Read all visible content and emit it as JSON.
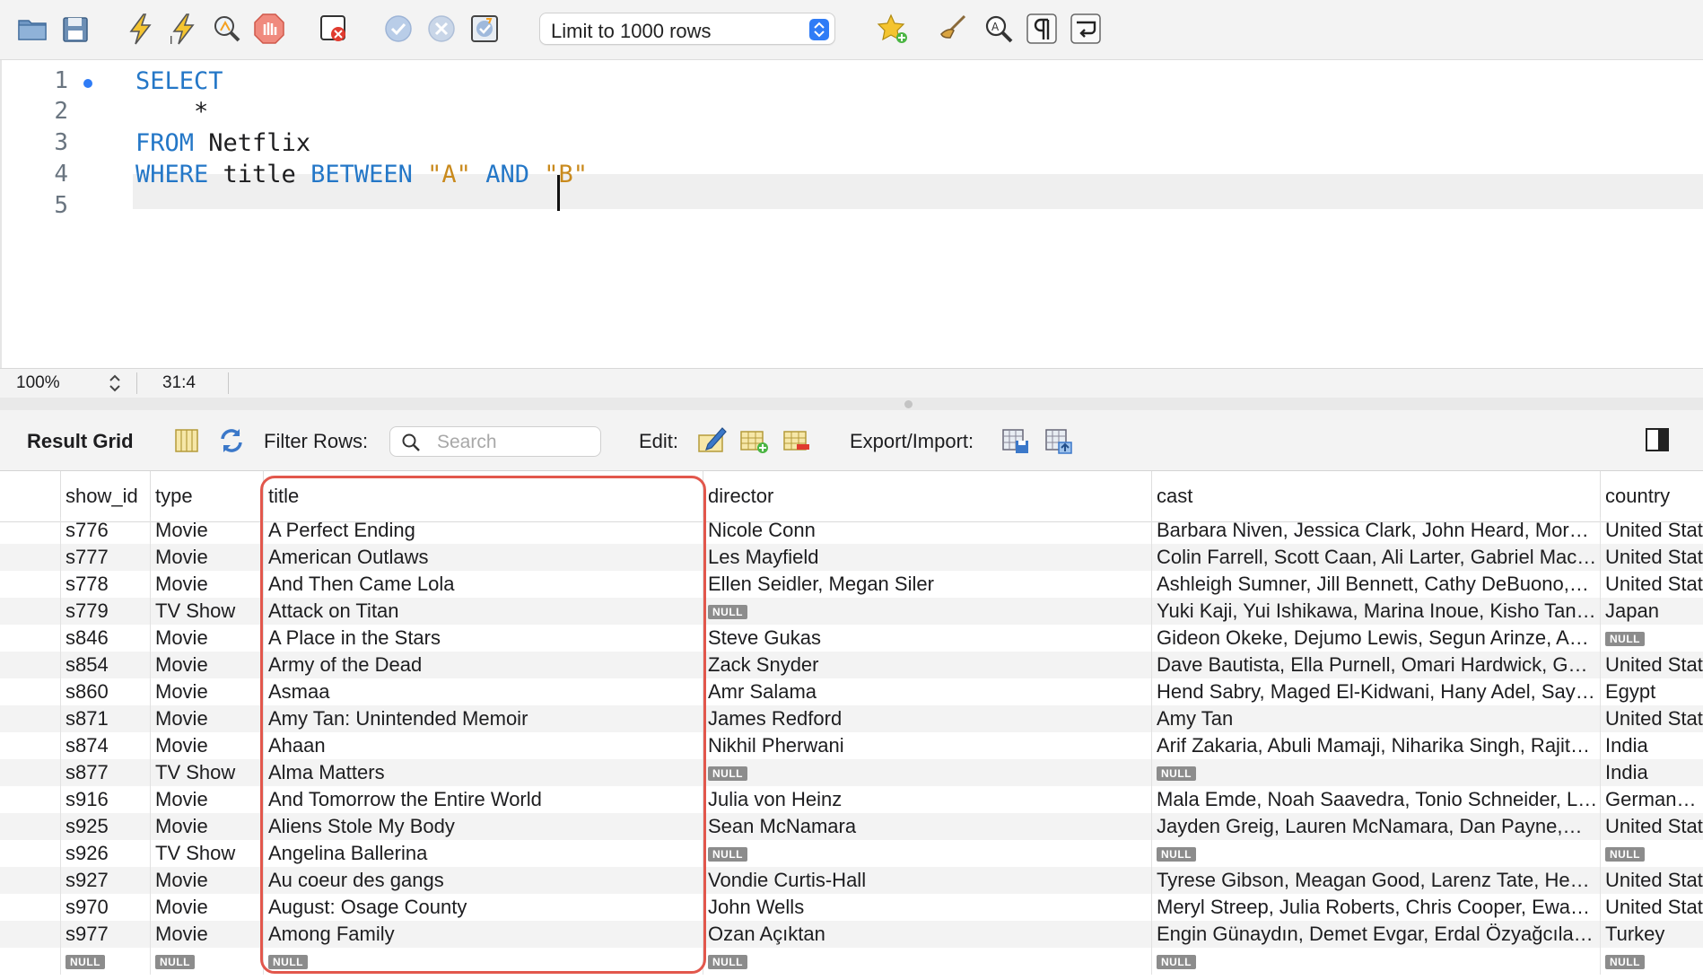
{
  "toolbar": {
    "icons": [
      "open-folder-icon",
      "save-icon",
      "execute-icon",
      "execute-current-icon",
      "explain-icon",
      "stop-icon",
      "toggle-error-icon",
      "commit-icon",
      "rollback-icon",
      "autocommit-icon",
      "bookmark-star-icon",
      "beautify-icon",
      "find-icon",
      "invisible-chars-icon",
      "word-wrap-icon"
    ],
    "limit_label": "Limit to 1000 rows"
  },
  "editor": {
    "lines": [
      {
        "no": "1",
        "parts": [
          {
            "t": "SELECT",
            "k": "kw"
          }
        ]
      },
      {
        "no": "2",
        "parts": [
          {
            "t": "    *",
            "k": "plain"
          }
        ]
      },
      {
        "no": "3",
        "parts": [
          {
            "t": "FROM",
            "k": "kw"
          },
          {
            "t": " Netflix",
            "k": "plain"
          }
        ]
      },
      {
        "no": "4",
        "parts": [
          {
            "t": "WHERE",
            "k": "kw"
          },
          {
            "t": " title ",
            "k": "plain"
          },
          {
            "t": "BETWEEN",
            "k": "kw"
          },
          {
            "t": " ",
            "k": "plain"
          },
          {
            "t": "\"A\"",
            "k": "str"
          },
          {
            "t": " ",
            "k": "plain"
          },
          {
            "t": "AND",
            "k": "kw"
          },
          {
            "t": " ",
            "k": "plain"
          },
          {
            "t": "\"B\"",
            "k": "str"
          }
        ]
      },
      {
        "no": "5",
        "parts": []
      }
    ]
  },
  "status": {
    "zoom": "100%",
    "cursor": "31:4"
  },
  "result_bar": {
    "result_grid_label": "Result Grid",
    "filter_label": "Filter Rows:",
    "search_placeholder": "Search",
    "edit_label": "Edit:",
    "export_label": "Export/Import:"
  },
  "grid": {
    "columns": [
      "show_id",
      "type",
      "title",
      "director",
      "cast",
      "country"
    ],
    "null_label": "NULL",
    "rows": [
      [
        "s776",
        "Movie",
        "A Perfect Ending",
        "Nicole Conn",
        "Barbara Niven, Jessica Clark, John Heard, Mor…",
        "United Stat"
      ],
      [
        "s777",
        "Movie",
        "American Outlaws",
        "Les Mayfield",
        "Colin Farrell, Scott Caan, Ali Larter, Gabriel Mac…",
        "United Stat"
      ],
      [
        "s778",
        "Movie",
        "And Then Came Lola",
        "Ellen Seidler, Megan Siler",
        "Ashleigh Sumner, Jill Bennett, Cathy DeBuono,…",
        "United Stat"
      ],
      [
        "s779",
        "TV Show",
        "Attack on Titan",
        null,
        "Yuki Kaji, Yui Ishikawa, Marina Inoue, Kisho Tan…",
        "Japan"
      ],
      [
        "s846",
        "Movie",
        "A Place in the Stars",
        "Steve Gukas",
        "Gideon Okeke, Dejumo Lewis, Segun Arinze, A…",
        null
      ],
      [
        "s854",
        "Movie",
        "Army of the Dead",
        "Zack Snyder",
        "Dave Bautista, Ella Purnell, Omari Hardwick, G…",
        "United Stat"
      ],
      [
        "s860",
        "Movie",
        "Asmaa",
        "Amr Salama",
        "Hend Sabry, Maged El-Kidwani, Hany Adel, Say…",
        "Egypt"
      ],
      [
        "s871",
        "Movie",
        "Amy Tan: Unintended Memoir",
        "James Redford",
        "Amy Tan",
        "United Stat"
      ],
      [
        "s874",
        "Movie",
        "Ahaan",
        "Nikhil Pherwani",
        "Arif Zakaria, Abuli Mamaji, Niharika Singh, Rajit…",
        "India"
      ],
      [
        "s877",
        "TV Show",
        "Alma Matters",
        null,
        null,
        "India"
      ],
      [
        "s916",
        "Movie",
        "And Tomorrow the Entire World",
        "Julia von Heinz",
        "Mala Emde, Noah Saavedra, Tonio Schneider, L…",
        "Germany, F"
      ],
      [
        "s925",
        "Movie",
        "Aliens Stole My Body",
        "Sean McNamara",
        "Jayden Greig, Lauren McNamara, Dan Payne,…",
        "United Stat"
      ],
      [
        "s926",
        "TV Show",
        "Angelina Ballerina",
        null,
        null,
        null
      ],
      [
        "s927",
        "Movie",
        "Au coeur des gangs",
        "Vondie Curtis-Hall",
        "Tyrese Gibson, Meagan Good, Larenz Tate, He…",
        "United Stat"
      ],
      [
        "s970",
        "Movie",
        "August: Osage County",
        "John Wells",
        "Meryl Streep, Julia Roberts, Chris Cooper, Ewa…",
        "United Stat"
      ],
      [
        "s977",
        "Movie",
        "Among Family",
        "Ozan Açıktan",
        "Engin Günaydın, Demet Evgar, Erdal Özyağcıla…",
        "Turkey"
      ],
      [
        null,
        null,
        null,
        null,
        null,
        null
      ]
    ]
  },
  "colors": {
    "keyword": "#2477c7",
    "string": "#c98a1d",
    "highlight": "#e2574c",
    "accent": "#2f7cf6"
  }
}
